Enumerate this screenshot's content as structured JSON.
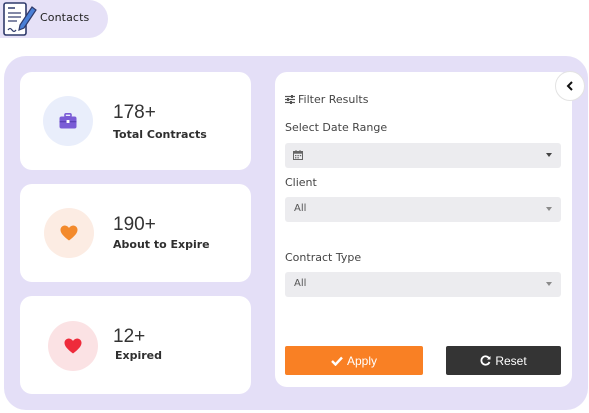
{
  "header": {
    "title": "Contacts",
    "icon": "contract-pen-icon"
  },
  "stats": [
    {
      "value": "178+",
      "label": "Total Contracts",
      "icon": "briefcase-icon",
      "color": "#7a5cd6"
    },
    {
      "value": "190+",
      "label": "About to Expire",
      "icon": "heart-icon",
      "color": "#f38a2c"
    },
    {
      "value": "12+",
      "label": "Expired",
      "icon": "heart-icon",
      "color": "#ee2b3b"
    }
  ],
  "filter": {
    "title": "Filter Results",
    "date_range": {
      "label": "Select Date Range",
      "value": ""
    },
    "client": {
      "label": "Client",
      "value": "All"
    },
    "contract_type": {
      "label": "Contract Type",
      "value": "All"
    },
    "apply_label": "Apply",
    "reset_label": "Reset"
  },
  "colors": {
    "panel": "#e4dff7",
    "apply": "#f98024",
    "reset": "#343434"
  }
}
